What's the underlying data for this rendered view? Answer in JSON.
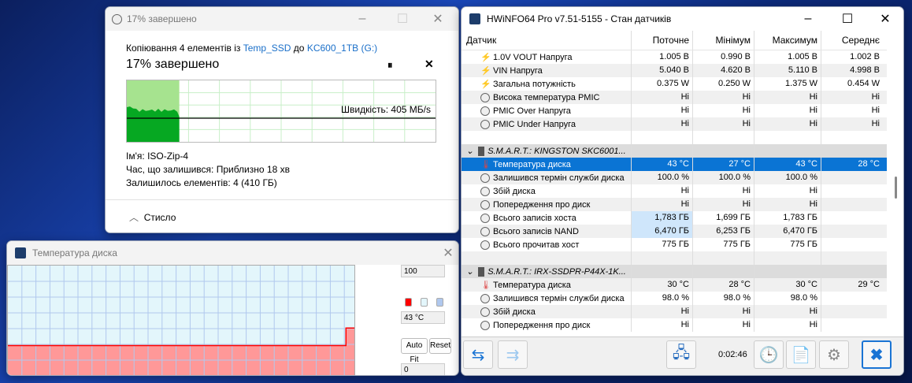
{
  "copy": {
    "title": "17% завершено",
    "line_prefix": "Копіювання 4 елементів із",
    "source": "Temp_SSD",
    "to": "до",
    "dest": "KC600_1TB (G:)",
    "heading": "17% завершено",
    "progress_percent": 17,
    "speed_label": "Швидкість: 405 МБ/s",
    "name_label": "Ім'я:",
    "name_value": "ISO-Zip-4",
    "time_label": "Час, що залишився:",
    "time_value": "Приблизно 18 хв",
    "items_label": "Залишилось елементів:",
    "items_value": "4 (410 ГБ)",
    "collapse_label": "Стисло"
  },
  "graph": {
    "title": "Температура диска",
    "max": "100",
    "min": "0",
    "current": "43 °C",
    "auto_fit": "Auto Fit",
    "reset": "Reset",
    "values": [
      27,
      27,
      27,
      27,
      27,
      27,
      27,
      27,
      27,
      27,
      27,
      27,
      27,
      27,
      27,
      27,
      27,
      27,
      27,
      27,
      27,
      27,
      27,
      27,
      43
    ],
    "colors": {
      "line": "#ff0000",
      "fill": "#ff9898",
      "bg": "#e3f6fb",
      "grid": "#b0c8ee"
    }
  },
  "hw": {
    "title": "HWiNFO64 Pro v7.51-5155 - Стан датчиків",
    "columns": [
      "Датчик",
      "Поточне",
      "Мінімум",
      "Максимум",
      "Середнє"
    ],
    "rows": [
      {
        "icon": "bolt",
        "label": "1.0V VOUT Напруга",
        "v": [
          "1.005 В",
          "0.990 В",
          "1.005 В",
          "1.002 В"
        ]
      },
      {
        "icon": "bolt",
        "label": "VIN Напруга",
        "v": [
          "5.040 В",
          "4.620 В",
          "5.110 В",
          "4.998 В"
        ]
      },
      {
        "icon": "bolt",
        "label": "Загальна потужність",
        "v": [
          "0.375 W",
          "0.250 W",
          "1.375 W",
          "0.454 W"
        ]
      },
      {
        "icon": "clock",
        "label": "Висока температура PMIC",
        "v": [
          "Ні",
          "Ні",
          "Ні",
          "Ні"
        ]
      },
      {
        "icon": "clock",
        "label": "PMIC Over Напруга",
        "v": [
          "Ні",
          "Ні",
          "Ні",
          "Ні"
        ]
      },
      {
        "icon": "clock",
        "label": "PMIC Under Напруга",
        "v": [
          "Ні",
          "Ні",
          "Ні",
          "Ні"
        ]
      },
      {
        "icon": "",
        "label": "",
        "v": [
          "",
          "",
          "",
          ""
        ]
      },
      {
        "icon": "group",
        "label": "S.M.A.R.T.: KINGSTON SKC6001...",
        "v": [
          "",
          "",
          "",
          ""
        ]
      },
      {
        "icon": "thermo",
        "label": "Температура диска",
        "v": [
          "43 °C",
          "27 °C",
          "43 °C",
          "28 °C"
        ],
        "selected": true
      },
      {
        "icon": "clock",
        "label": "Залишився термін служби диска",
        "v": [
          "100.0 %",
          "100.0 %",
          "100.0 %",
          ""
        ]
      },
      {
        "icon": "clock",
        "label": "Збій диска",
        "v": [
          "Ні",
          "Ні",
          "Ні",
          ""
        ]
      },
      {
        "icon": "clock",
        "label": "Попередження про диск",
        "v": [
          "Ні",
          "Ні",
          "Ні",
          ""
        ]
      },
      {
        "icon": "clock",
        "label": "Всього записів хоста",
        "v": [
          "1,783 ГБ",
          "1,699 ГБ",
          "1,783 ГБ",
          ""
        ],
        "hl": true
      },
      {
        "icon": "clock",
        "label": "Всього записів NAND",
        "v": [
          "6,470 ГБ",
          "6,253 ГБ",
          "6,470 ГБ",
          ""
        ],
        "hl": true
      },
      {
        "icon": "clock",
        "label": "Всього прочитав хост",
        "v": [
          "775 ГБ",
          "775 ГБ",
          "775 ГБ",
          ""
        ]
      },
      {
        "icon": "",
        "label": "",
        "v": [
          "",
          "",
          "",
          ""
        ]
      },
      {
        "icon": "group",
        "label": "S.M.A.R.T.: IRX-SSDPR-P44X-1K...",
        "v": [
          "",
          "",
          "",
          ""
        ]
      },
      {
        "icon": "thermo",
        "label": "Температура диска",
        "v": [
          "30 °C",
          "28 °C",
          "30 °C",
          "29 °C"
        ]
      },
      {
        "icon": "clock",
        "label": "Залишився термін служби диска",
        "v": [
          "98.0 %",
          "98.0 %",
          "98.0 %",
          ""
        ]
      },
      {
        "icon": "clock",
        "label": "Збій диска",
        "v": [
          "Ні",
          "Ні",
          "Ні",
          ""
        ]
      },
      {
        "icon": "clock",
        "label": "Попередження про диск",
        "v": [
          "Ні",
          "Ні",
          "Ні",
          ""
        ]
      }
    ],
    "timer": "0:02:46"
  }
}
